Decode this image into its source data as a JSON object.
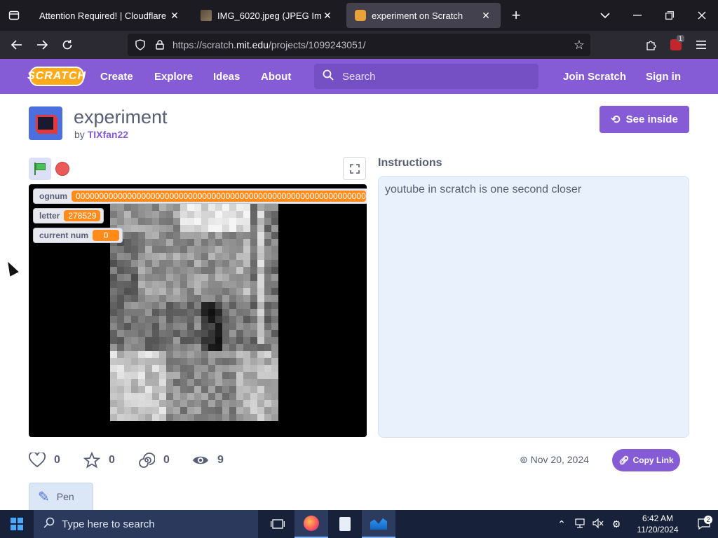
{
  "browser": {
    "tabs": [
      {
        "title": "Attention Required! | Cloudflare",
        "active": false
      },
      {
        "title": "IMG_6020.jpeg (JPEG Image, 45",
        "active": false
      },
      {
        "title": "experiment on Scratch",
        "active": true
      }
    ],
    "url_prefix": "https://scratch.",
    "url_host": "mit.edu",
    "url_path": "/projects/1099243051/",
    "extension_badge": "1"
  },
  "scratch_header": {
    "logo_text": "SCRATCH",
    "nav": {
      "create": "Create",
      "explore": "Explore",
      "ideas": "Ideas",
      "about": "About"
    },
    "search_placeholder": "Search",
    "join": "Join Scratch",
    "signin": "Sign in"
  },
  "project": {
    "title": "experiment",
    "by": "by",
    "author": "TIXfan22",
    "see_inside": "See inside",
    "instructions_title": "Instructions",
    "instructions": "youtube in scratch is one second closer",
    "stats": {
      "loves": "0",
      "favorites": "0",
      "remixes": "0",
      "views": "9"
    },
    "date": "Nov 20, 2024",
    "copy_link": "Copy Link",
    "extension": "Pen"
  },
  "stage": {
    "monitors": [
      {
        "label": "ognum",
        "value": "00000000000000000000000000000000000000000000000000000000000000"
      },
      {
        "label": "letter",
        "value": "278529"
      },
      {
        "label": "current num",
        "value": "0"
      }
    ]
  },
  "taskbar": {
    "search_placeholder": "Type here to search",
    "time": "6:42 AM",
    "date": "11/20/2024",
    "notifications": "2"
  }
}
